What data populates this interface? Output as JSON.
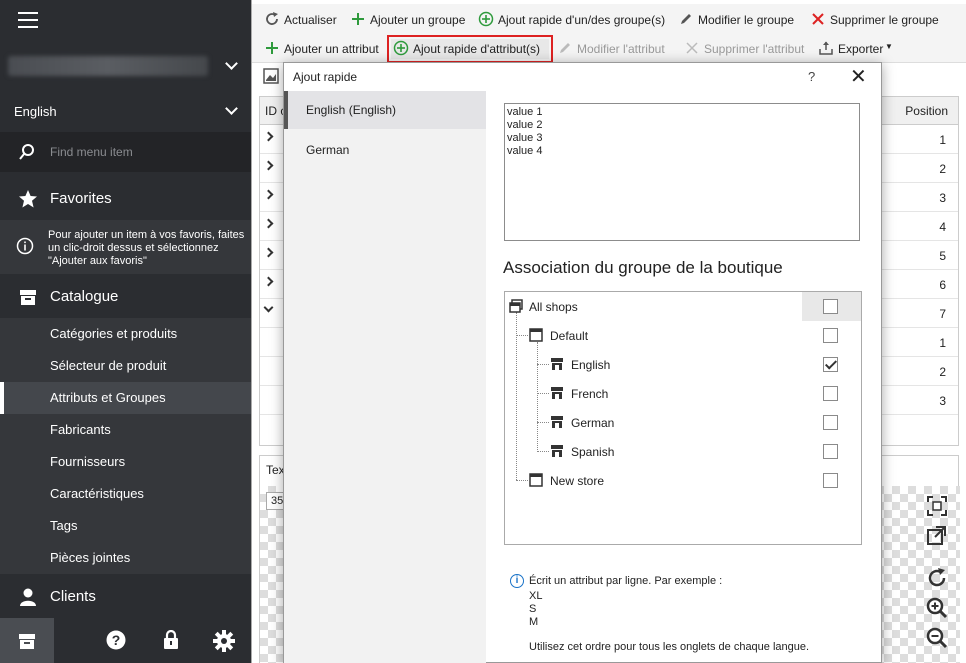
{
  "sidebar": {
    "language": "English",
    "search_placeholder": "Find menu item",
    "favorites_label": "Favorites",
    "favorites_tip": "Pour ajouter un item à vos favoris, faites un clic-droit dessus et sélectionnez \"Ajouter aux favoris\"",
    "catalog_label": "Catalogue",
    "catalog_items": [
      {
        "label": "Catégories et produits"
      },
      {
        "label": "Sélecteur de produit"
      },
      {
        "label": "Attributs et Groupes",
        "active": true
      },
      {
        "label": "Fabricants"
      },
      {
        "label": "Fournisseurs"
      },
      {
        "label": "Caractéristiques"
      },
      {
        "label": "Tags"
      },
      {
        "label": "Pièces jointes"
      }
    ],
    "clients_label": "Clients"
  },
  "toolbar1": {
    "refresh": "Actualiser",
    "add_group": "Ajouter un groupe",
    "quick_add_group": "Ajout rapide d'un/des groupe(s)",
    "edit_group": "Modifier le groupe",
    "delete_group": "Supprimer le groupe"
  },
  "toolbar2": {
    "add_attribute": "Ajouter un attribut",
    "quick_add_attribute": "Ajout rapide d'attribut(s)",
    "edit_attribute": "Modifier l'attribut",
    "delete_attribute": "Supprimer l'attribut",
    "export": "Exporter"
  },
  "grid": {
    "col_id": "ID c",
    "col_position": "Position",
    "positions": [
      "1",
      "2",
      "3",
      "4",
      "5",
      "6",
      "7",
      "1",
      "2",
      "3"
    ]
  },
  "bottom_panel": {
    "tab_label": "Tex",
    "field_value": "35"
  },
  "dialog": {
    "title": "Ajout rapide",
    "help_glyph": "?",
    "close_glyph": "✕",
    "languages": [
      {
        "label": "English (English)",
        "active": true
      },
      {
        "label": "German"
      }
    ],
    "values": [
      "value 1",
      "value 2",
      "value 3",
      "value 4"
    ],
    "association_title": "Association du groupe de la boutique",
    "tree": [
      {
        "label": "All shops",
        "checked": false
      },
      {
        "label": "Default",
        "checked": false
      },
      {
        "label": "English",
        "checked": true
      },
      {
        "label": "French",
        "checked": false
      },
      {
        "label": "German",
        "checked": false
      },
      {
        "label": "Spanish",
        "checked": false
      },
      {
        "label": "New store",
        "checked": false
      }
    ],
    "help_text": "Écrit un attribut par ligne. Par exemple :",
    "help_examples": [
      "XL",
      "S",
      "M"
    ],
    "help_note": "Utilisez cet ordre pour tous les onglets de chaque langue."
  },
  "colors": {
    "sidebar_bg": "#2b2d31",
    "highlight": "#dd2222",
    "accent_green": "#2e9a3c"
  }
}
